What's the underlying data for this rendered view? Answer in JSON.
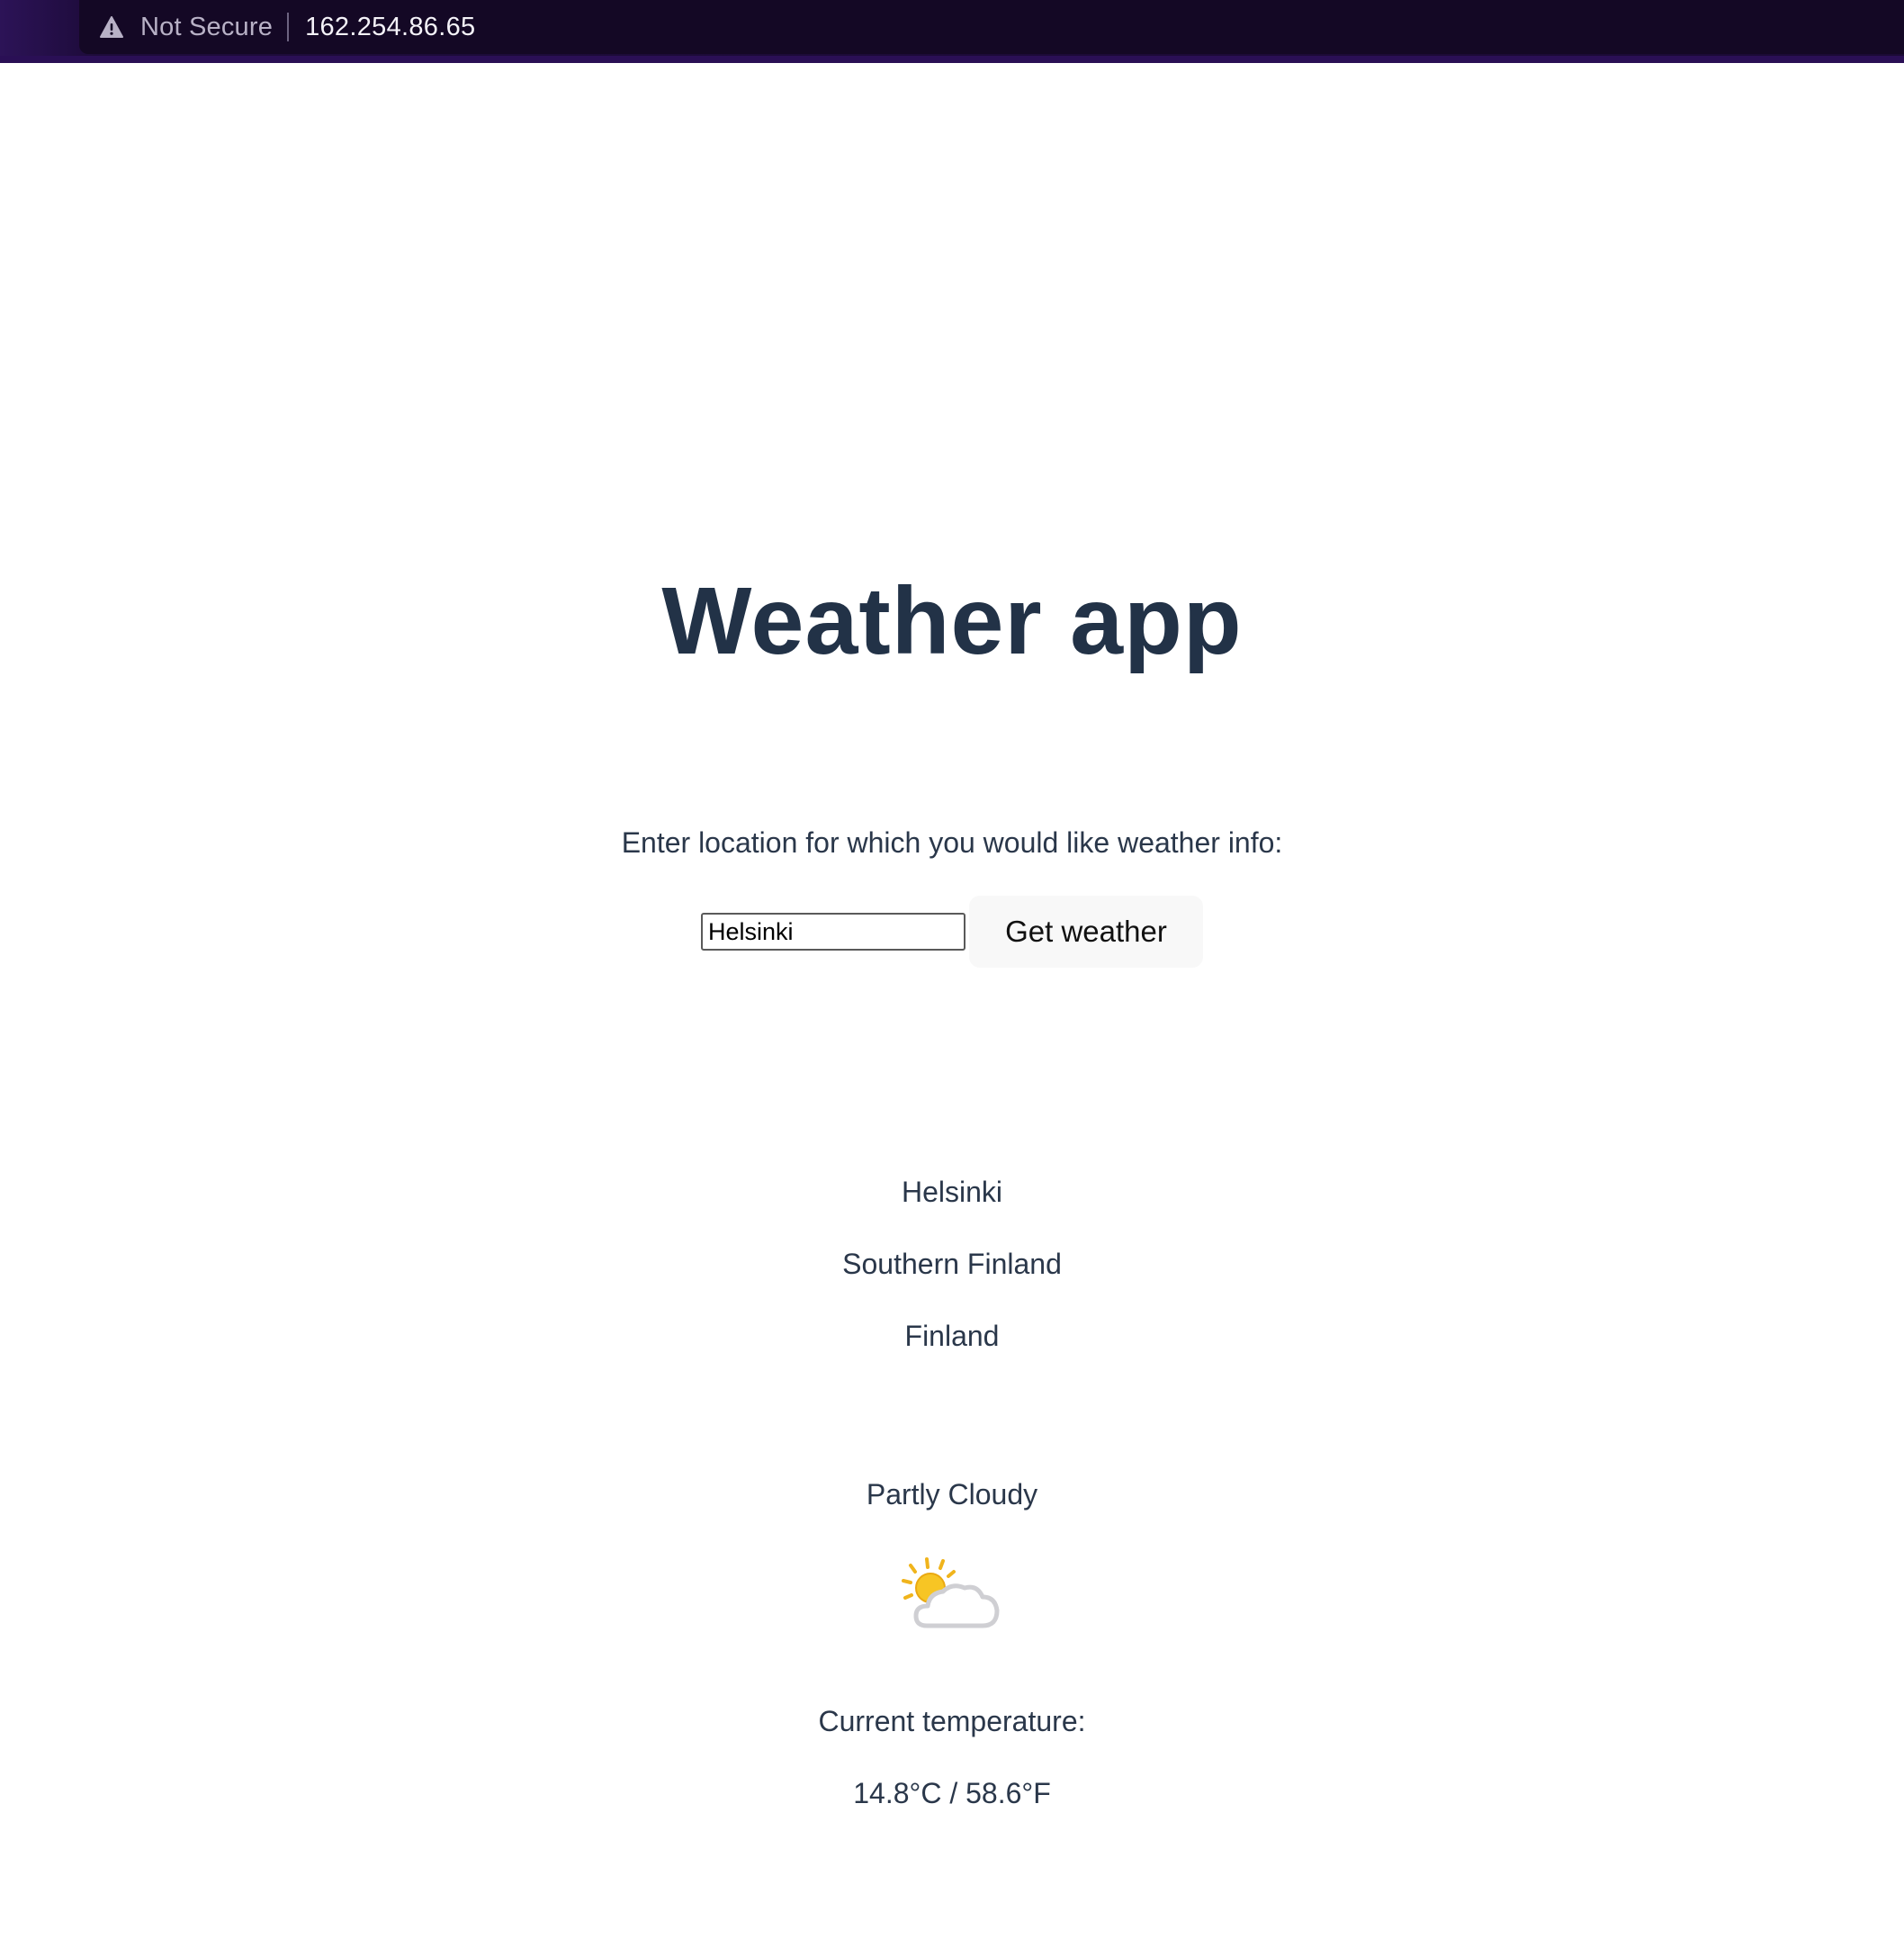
{
  "browser": {
    "security_label": "Not Secure",
    "url": "162.254.86.65",
    "warning_icon": "warning-triangle-icon"
  },
  "app": {
    "title": "Weather app",
    "prompt": "Enter location for which you would like weather info:",
    "search": {
      "value": "Helsinki",
      "button_label": "Get weather"
    }
  },
  "result": {
    "city": "Helsinki",
    "region": "Southern Finland",
    "country": "Finland",
    "condition": "Partly Cloudy",
    "condition_icon": "partly-cloudy-icon",
    "temperature_label": "Current temperature:",
    "temperature_value": "14.8°C / 58.6°F"
  },
  "colors": {
    "browser_bar": "#1b0a35",
    "text": "#27364a",
    "title": "#223247",
    "button_bg": "#f8f8f8"
  }
}
